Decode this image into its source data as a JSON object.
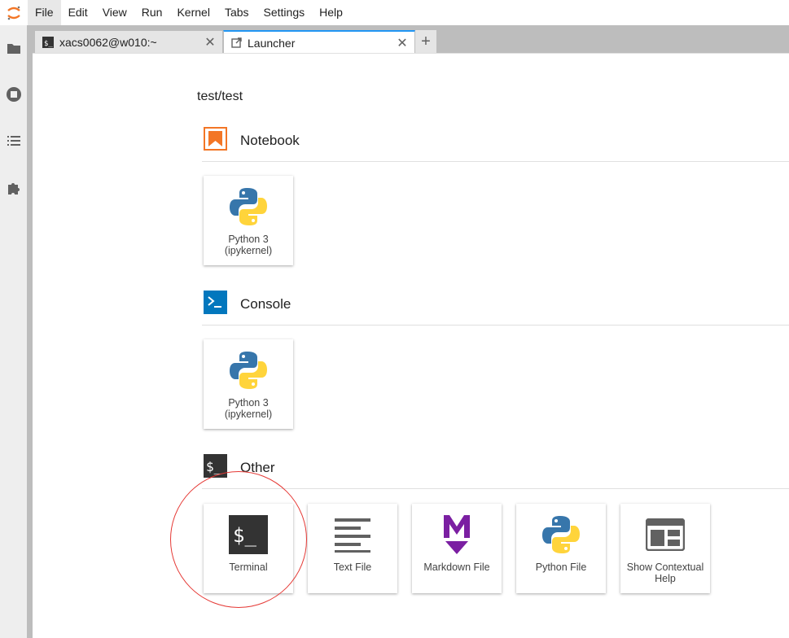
{
  "menu": {
    "items": [
      "File",
      "Edit",
      "View",
      "Run",
      "Kernel",
      "Tabs",
      "Settings",
      "Help"
    ]
  },
  "sidebar": {
    "icons": [
      "folder-icon",
      "running-kernels-icon",
      "table-of-contents-icon",
      "extension-icon"
    ]
  },
  "tabs": [
    {
      "label": "xacs0062@w010:~",
      "icon": "terminal-icon",
      "close": "✕"
    },
    {
      "label": "Launcher",
      "icon": "launcher-icon",
      "close": "✕"
    }
  ],
  "add_tab": "+",
  "launcher": {
    "cwd": "test/test",
    "sections": {
      "notebook": {
        "title": "Notebook",
        "cards": [
          {
            "label": "Python 3 (ipykernel)"
          }
        ]
      },
      "console": {
        "title": "Console",
        "cards": [
          {
            "label": "Python 3 (ipykernel)"
          }
        ]
      },
      "other": {
        "title": "Other",
        "cards": [
          {
            "label": "Terminal"
          },
          {
            "label": "Text File"
          },
          {
            "label": "Markdown File"
          },
          {
            "label": "Python File"
          },
          {
            "label": "Show Contextual Help"
          }
        ]
      }
    }
  },
  "colors": {
    "accent": "#2196f3",
    "jupyter_orange": "#f37626",
    "console_blue": "#0277bd",
    "markdown_purple": "#7b1fa2",
    "annotation_red": "#e53935"
  }
}
